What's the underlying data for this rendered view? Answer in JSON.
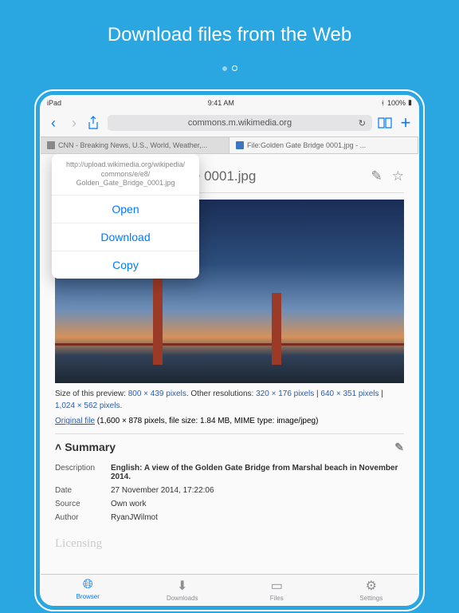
{
  "promo_title": "Download files from the Web",
  "statusbar": {
    "device": "iPad",
    "carrier": "",
    "time": "9:41 AM",
    "battery": "100%"
  },
  "toolbar": {
    "url": "commons.m.wikimedia.org"
  },
  "tabs": [
    {
      "label": "CNN - Breaking News, U.S., World, Weather,..."
    },
    {
      "label": "File:Golden Gate Bridge 0001.jpg - ..."
    }
  ],
  "popover": {
    "url_line1": "http://upload.wikimedia.org/wikipedia/",
    "url_line2": "commons/e/e8/",
    "url_line3": "Golden_Gate_Bridge_0001.jpg",
    "open": "Open",
    "download": "Download",
    "copy": "Copy"
  },
  "page": {
    "title": "File:Golden Gate Bridge 0001.jpg",
    "caption_prefix": "Size of this preview: ",
    "size_main": "800 × 439 pixels",
    "caption_mid": ". Other resolutions: ",
    "size_a": "320 × 176 pixels",
    "size_b": "640 × 351 pixels",
    "size_c": "1,024 × 562 pixels",
    "original_label": "Original file",
    "original_info": " (1,600 × 878 pixels, file size: 1.84 MB, MIME type: image/jpeg)",
    "summary": "Summary",
    "licensing": "Licensing",
    "meta": {
      "description_k": "Description",
      "description_v": "English: A view of the Golden Gate Bridge from Marshal beach in November 2014.",
      "date_k": "Date",
      "date_v": "27 November 2014, 17:22:06",
      "source_k": "Source",
      "source_v": "Own work",
      "author_k": "Author",
      "author_v": "RyanJWilmot"
    }
  },
  "bottombar": {
    "browser": "Browser",
    "downloads": "Downloads",
    "files": "Files",
    "settings": "Settings"
  }
}
